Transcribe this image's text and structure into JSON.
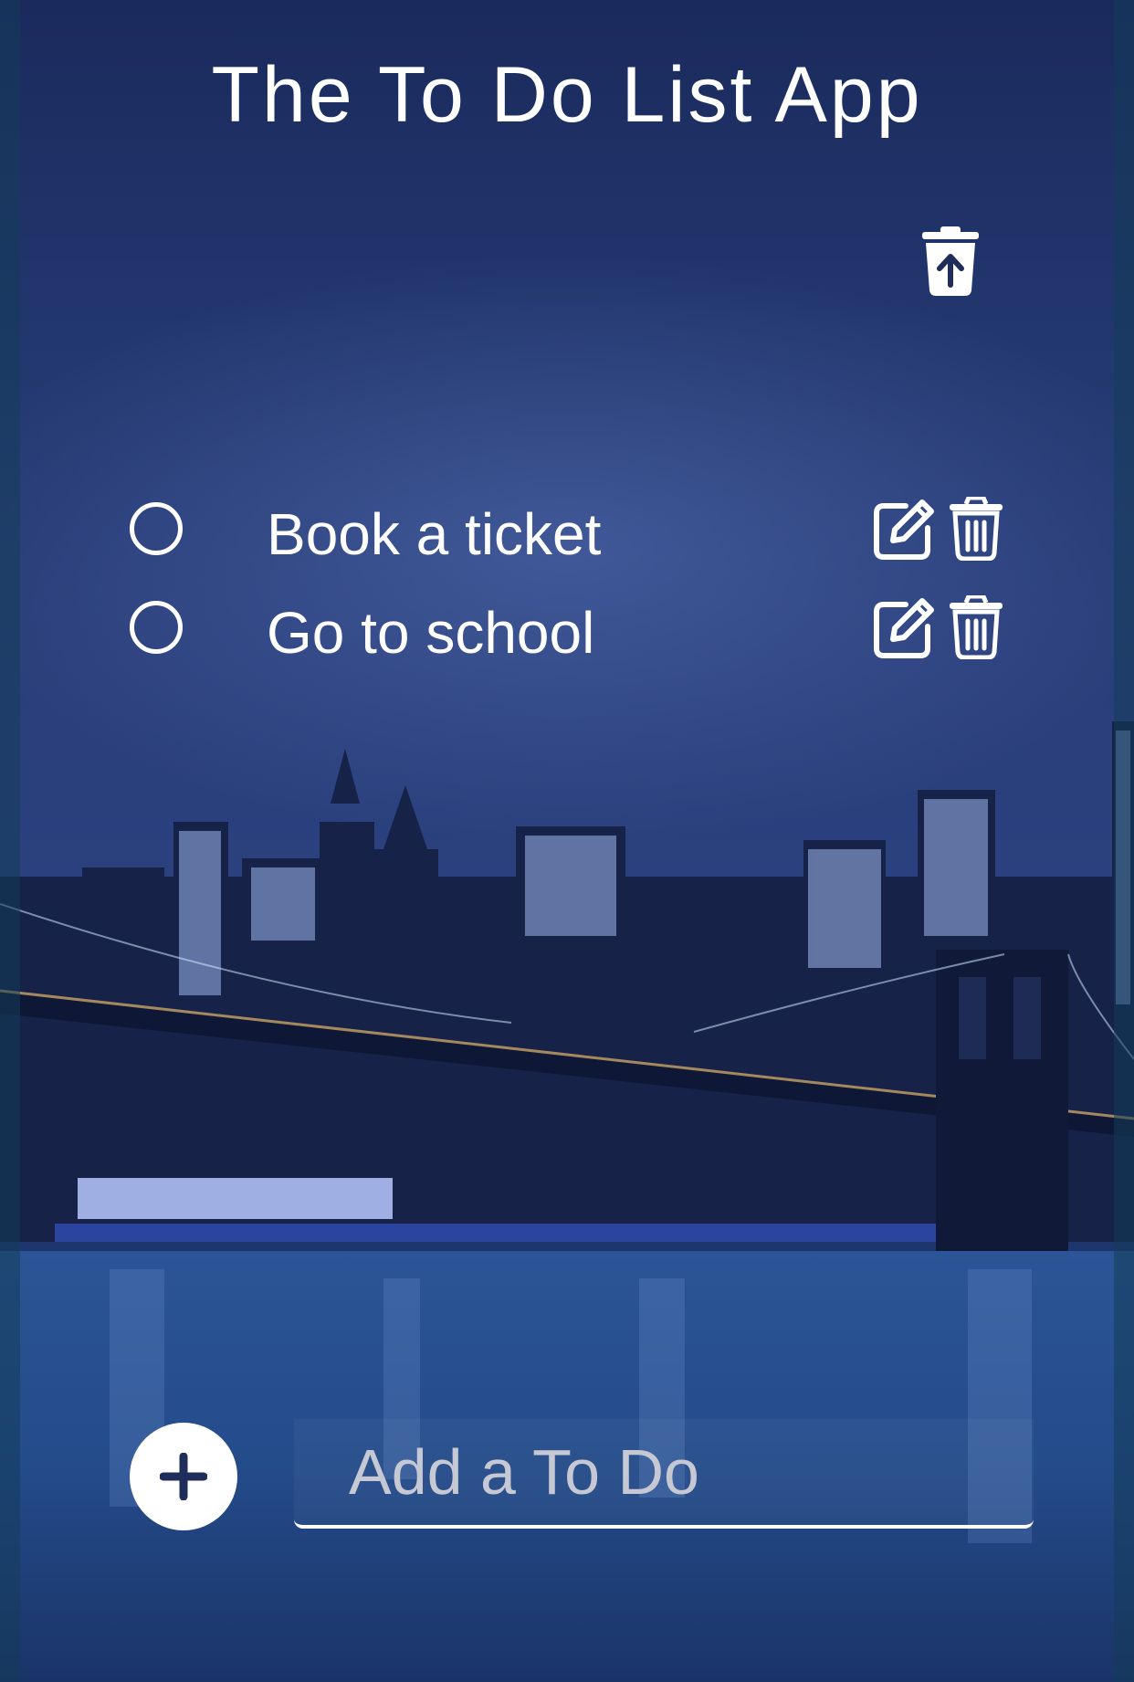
{
  "app": {
    "title": "The To Do List App"
  },
  "toolbar": {
    "clear_icon": "trash-arrow-up-icon"
  },
  "todos": [
    {
      "text": "Book a ticket",
      "done": false
    },
    {
      "text": "Go to school",
      "done": false
    }
  ],
  "add": {
    "placeholder": "Add a To Do",
    "value": "",
    "button_icon": "plus-icon"
  },
  "colors": {
    "accent": "#ffffff",
    "icon_dark": "#1e2d5a",
    "placeholder": "#c6c9d4"
  }
}
